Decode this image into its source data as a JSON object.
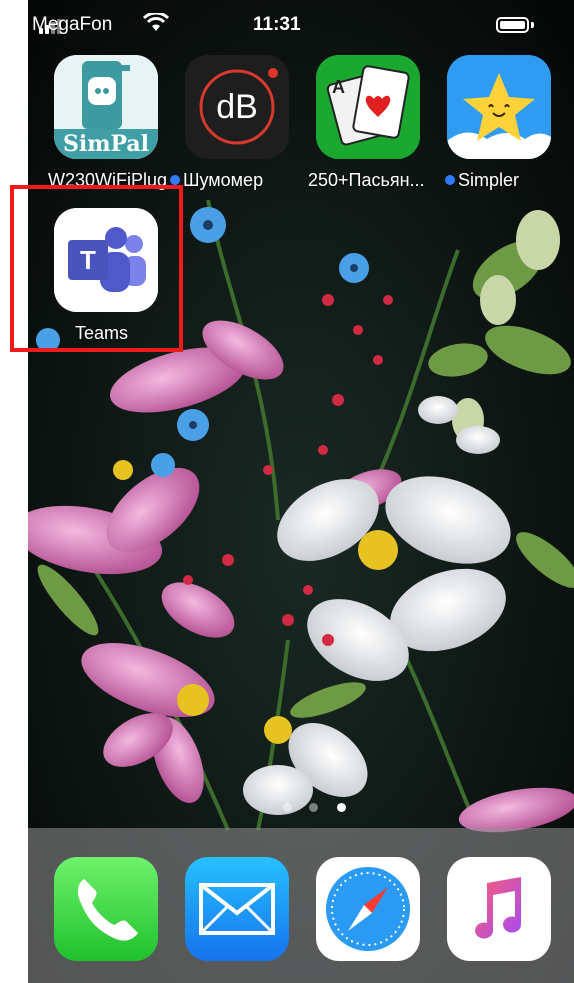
{
  "status_bar": {
    "carrier": "MegaFon",
    "time": "11:31"
  },
  "home_apps": [
    {
      "name": "W230WiFiPlug",
      "icon_text": "SimPal",
      "new_dot": false
    },
    {
      "name": "Шумомер",
      "icon_text": "dB",
      "new_dot": true
    },
    {
      "name": "250+Пасьян...",
      "icon_text": "A",
      "new_dot": false
    },
    {
      "name": "Simpler",
      "icon_text": "",
      "new_dot": true
    },
    {
      "name": "Teams",
      "icon_text": "T",
      "new_dot": false
    }
  ],
  "page_indicator": {
    "pages": 3,
    "current": 3
  },
  "dock": [
    {
      "name": "Phone",
      "icon": "phone-icon"
    },
    {
      "name": "Mail",
      "icon": "envelope-icon"
    },
    {
      "name": "Safari",
      "icon": "compass-icon"
    },
    {
      "name": "Music",
      "icon": "music-note-icon"
    }
  ],
  "colors": {
    "highlight": "#ef1b1b",
    "new_app_dot": "#2f7bff"
  }
}
